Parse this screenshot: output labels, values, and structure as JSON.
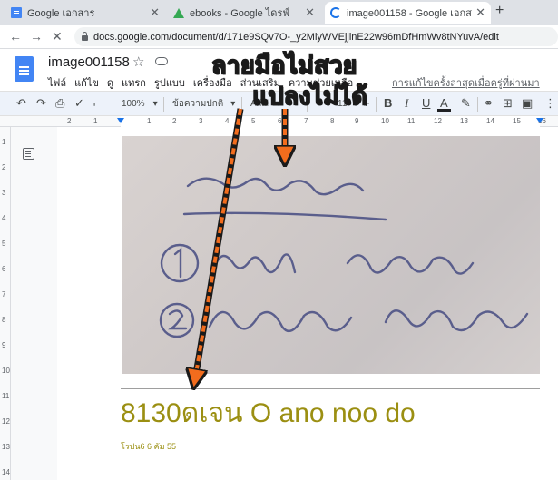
{
  "browser": {
    "tabs": [
      {
        "title": "Google เอกสาร",
        "icon": "docs-icon"
      },
      {
        "title": "ebooks - Google ไดรฟ์",
        "icon": "drive-icon"
      },
      {
        "title": "image001158 - Google เอกสาร",
        "icon": "loading-icon"
      }
    ],
    "new_tab": "+",
    "url": "docs.google.com/document/d/171e9SQv7O-_y2MlyWVEjjinE22w96mDfHmWv8tNYuvA/edit"
  },
  "docs": {
    "title": "image001158",
    "menu": [
      "ไฟล์",
      "แก้ไข",
      "ดู",
      "แทรก",
      "รูปแบบ",
      "เครื่องมือ",
      "ส่วนเสริม",
      "ความช่วยเหลือ"
    ],
    "last_edit": "การแก้ไขครั้งล่าสุดเมื่อครู่ที่ผ่านมา"
  },
  "toolbar": {
    "zoom": "100%",
    "style": "ข้อความปกติ",
    "font": "Arial",
    "font_size": "11",
    "minus": "−",
    "plus": "+",
    "bold": "B",
    "italic": "I",
    "underline": "U",
    "text_color": "A",
    "colors": {
      "text_color_bar": "#202124"
    }
  },
  "ruler": {
    "numbers": [
      "2",
      "1",
      "1",
      "2",
      "3",
      "4",
      "5",
      "6",
      "7",
      "8",
      "9",
      "10",
      "11",
      "12",
      "13",
      "14",
      "15",
      "16"
    ]
  },
  "vruler": {
    "numbers": [
      "1",
      "2",
      "3",
      "4",
      "5",
      "6",
      "7",
      "8",
      "9",
      "10",
      "11",
      "12",
      "13",
      "14"
    ]
  },
  "document": {
    "handwriting": {
      "line1": "ลายมือไม่สวย",
      "line2": "① ข้าว ทอดฟัก",
      "line3": "② โรบมนฟด ต้มจือ"
    },
    "ocr_result": "8130ดเจน O ano noo do",
    "ocr_small": "โรปน6 6 คัม 55"
  },
  "annotation": {
    "line1": "ลายมือไม่สวย",
    "line2": "แปลงไม่ได้",
    "color": "#f26c1d"
  }
}
